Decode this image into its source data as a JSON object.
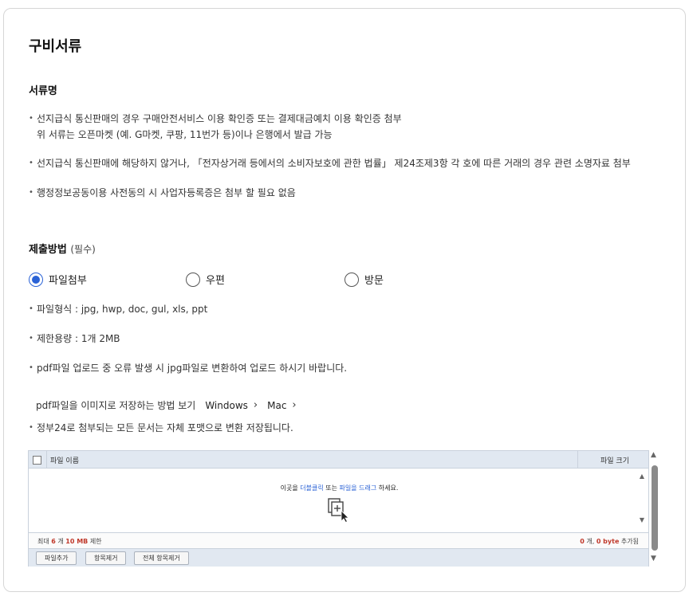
{
  "page": {
    "title": "구비서류"
  },
  "documents": {
    "heading": "서류명",
    "items": [
      {
        "line1": "선지급식 통신판매의 경우 구매안전서비스 이용 확인증 또는 결제대금예치 이용 확인증 첨부",
        "line2": "위 서류는 오픈마켓 (예. G마켓, 쿠팡, 11번가 등)이나 은행에서 발급 가능"
      },
      {
        "line1": "선지급식 통신판매에 해당하지 않거나, 「전자상거래 등에서의 소비자보호에 관한 법률」 제24조제3항 각 호에 따른 거래의 경우 관련 소명자료 첨부"
      },
      {
        "line1": "행정정보공동이용 사전동의 시 사업자등록증은 첨부 할 필요 없음"
      }
    ]
  },
  "submission": {
    "heading": "제출방법",
    "required_note": "(필수)",
    "options": [
      {
        "label": "파일첨부",
        "checked": true
      },
      {
        "label": "우편",
        "checked": false
      },
      {
        "label": "방문",
        "checked": false
      }
    ],
    "notes": [
      "파일형식 : jpg, hwp, doc, gul, xls, ppt",
      "제한용량 : 1개 2MB",
      "pdf파일 업로드 중 오류 발생 시 jpg파일로 변환하여 업로드 하시기 바랍니다."
    ],
    "pdf_guide": {
      "label": "pdf파일을 이미지로 저장하는 방법 보기",
      "links": [
        "Windows",
        "Mac"
      ]
    },
    "final_note": "정부24로 첨부되는 모든 문서는 자체 포맷으로 변환 저장됩니다."
  },
  "uploader": {
    "col_name": "파일 이름",
    "col_size": "파일 크기",
    "hint_pre": "이곳을 ",
    "hint_dblclick": "더블클릭",
    "hint_mid": " 또는 ",
    "hint_drag": "파일을 드래그",
    "hint_post": " 하세요.",
    "limit_pre": "최대 ",
    "limit_count": "6",
    "limit_mid": " 개 ",
    "limit_size": "10 MB",
    "limit_post": " 제한",
    "count_files": "0",
    "count_files_unit": " 개, ",
    "count_bytes": "0 byte",
    "count_post": " 추가됨",
    "buttons": [
      "파일추가",
      "항목제거",
      "전체 항목제거"
    ]
  },
  "colors": {
    "accent": "#2a62d6",
    "warn": "#c0392b",
    "uploader_header": "#e1e8f1"
  }
}
